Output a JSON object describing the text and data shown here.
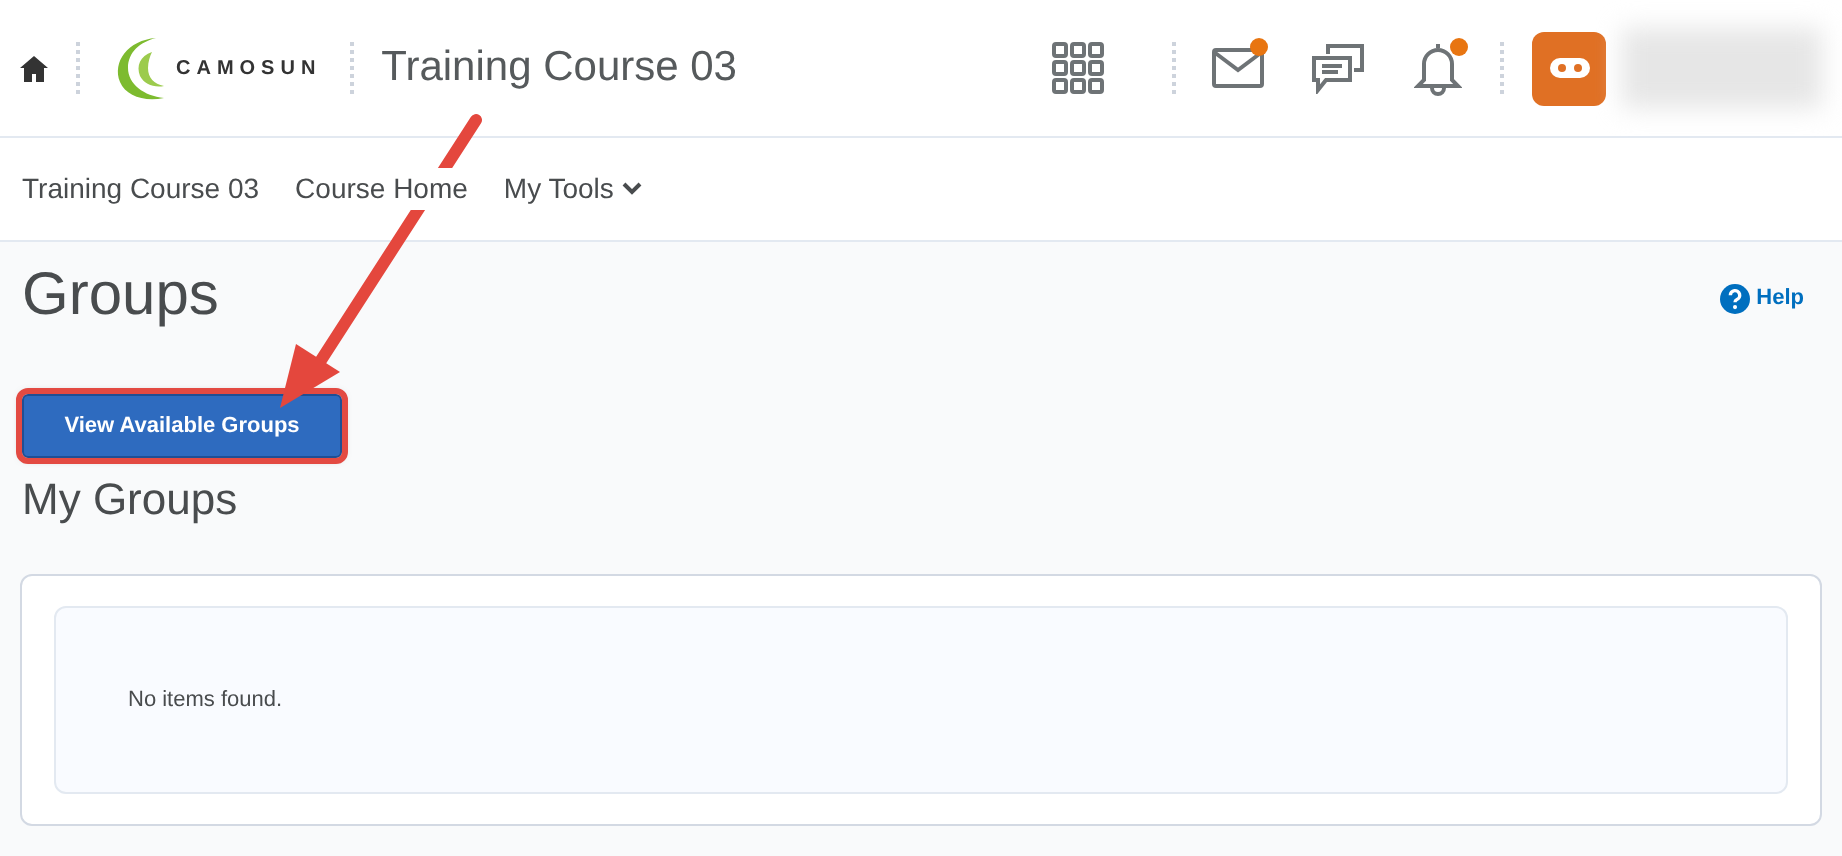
{
  "header": {
    "logo_text": "CAMOSUN",
    "course_title": "Training Course 03",
    "icons": [
      {
        "kind": "grid",
        "notification": false
      },
      {
        "kind": "mail",
        "notification": true
      },
      {
        "kind": "chat",
        "notification": false
      },
      {
        "kind": "bell",
        "notification": true
      }
    ]
  },
  "nav": [
    {
      "label": "Training Course 03",
      "dropdown": false
    },
    {
      "label": "Course Home",
      "dropdown": false
    },
    {
      "label": "My Tools",
      "dropdown": true
    }
  ],
  "page": {
    "title": "Groups",
    "help": "Help",
    "button": {
      "label": "View Available Groups",
      "highlighted": true
    },
    "section_title": "My Groups",
    "empty_message": "No items found."
  },
  "annotation": {
    "kind": "arrow"
  }
}
